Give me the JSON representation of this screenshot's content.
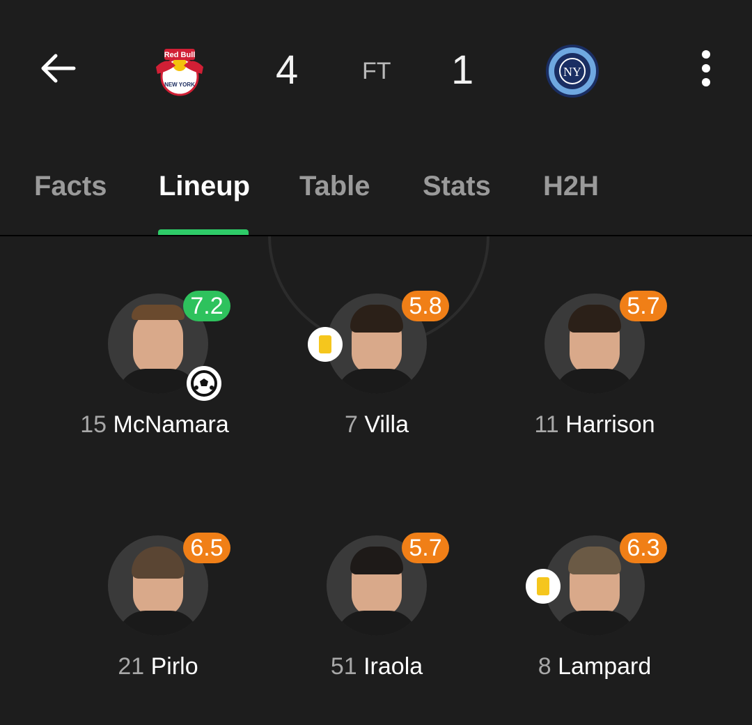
{
  "header": {
    "home_team_crest_text": "Red Bull NEW YORK",
    "away_team_crest_text": "NEW YORK CITY FOOTBALL CLUB",
    "home_score": "4",
    "status": "FT",
    "away_score": "1"
  },
  "tabs": [
    {
      "label": "Facts"
    },
    {
      "label": "Lineup"
    },
    {
      "label": "Table"
    },
    {
      "label": "Stats"
    },
    {
      "label": "H2H"
    }
  ],
  "active_tab": "Lineup",
  "players": [
    {
      "number": "15",
      "name": "McNamara",
      "rating": "7.2",
      "rating_color": "#2ec25d",
      "event": "goal"
    },
    {
      "number": "7",
      "name": "Villa",
      "rating": "5.8",
      "rating_color": "#f07f17",
      "event": "yellow-card"
    },
    {
      "number": "11",
      "name": "Harrison",
      "rating": "5.7",
      "rating_color": "#f07f17",
      "event": ""
    },
    {
      "number": "21",
      "name": "Pirlo",
      "rating": "6.5",
      "rating_color": "#f07f17",
      "event": ""
    },
    {
      "number": "51",
      "name": "Iraola",
      "rating": "5.7",
      "rating_color": "#f07f17",
      "event": ""
    },
    {
      "number": "8",
      "name": "Lampard",
      "rating": "6.3",
      "rating_color": "#f07f17",
      "event": "yellow-card"
    }
  ],
  "colors": {
    "background": "#1d1d1d",
    "accent": "#2ecb68",
    "rating_good": "#2ec25d",
    "rating_ok": "#f07f17",
    "yellow_card": "#f5c61d"
  }
}
